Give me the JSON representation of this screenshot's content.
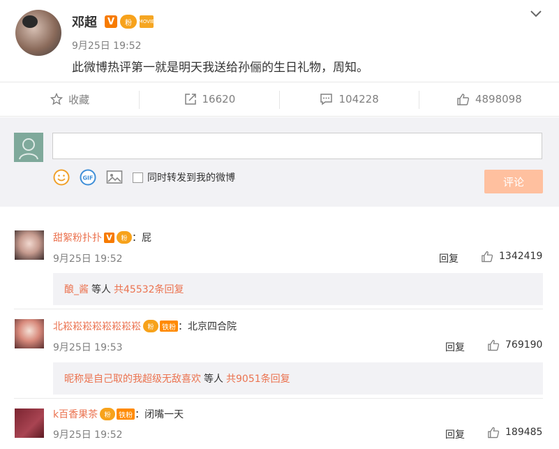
{
  "post": {
    "author": "邓超",
    "time": "9月25日 19:52",
    "text": "此微博热评第一就是明天我送给孙俪的生日礼物，周知。",
    "badges": {
      "verified": "V",
      "fan": "粉",
      "movie": "MOVIE"
    }
  },
  "actions": {
    "favorite_label": "收藏",
    "repost_count": "16620",
    "comment_count": "104228",
    "like_count": "4898098"
  },
  "composer": {
    "input_value": "",
    "sync_label": "同时转发到我的微博",
    "submit_label": "评论"
  },
  "comments": [
    {
      "name": "甜絮粉扑扑",
      "text": "：屁",
      "time": "9月25日 19:52",
      "reply_label": "回复",
      "likes": "1342419",
      "sub_user": "酿_酱",
      "sub_mid": "等人",
      "sub_count": "共45532条回复"
    },
    {
      "name": "北崧崧崧崧崧崧崧崧",
      "badge": "铁粉",
      "text": "：北京四合院",
      "time": "9月25日 19:53",
      "reply_label": "回复",
      "likes": "769190",
      "sub_user": "昵称是自己取的我超级无敌喜欢",
      "sub_mid": "等人",
      "sub_count": "共9051条回复"
    },
    {
      "name": "k百香果茶",
      "badge": "铁粉",
      "text": "：闭嘴一天",
      "time": "9月25日 19:52",
      "reply_label": "回复",
      "likes": "189485"
    }
  ],
  "colors": {
    "accent": "#eb7350",
    "button": "#ffc09f",
    "panel": "#f2f2f5"
  }
}
